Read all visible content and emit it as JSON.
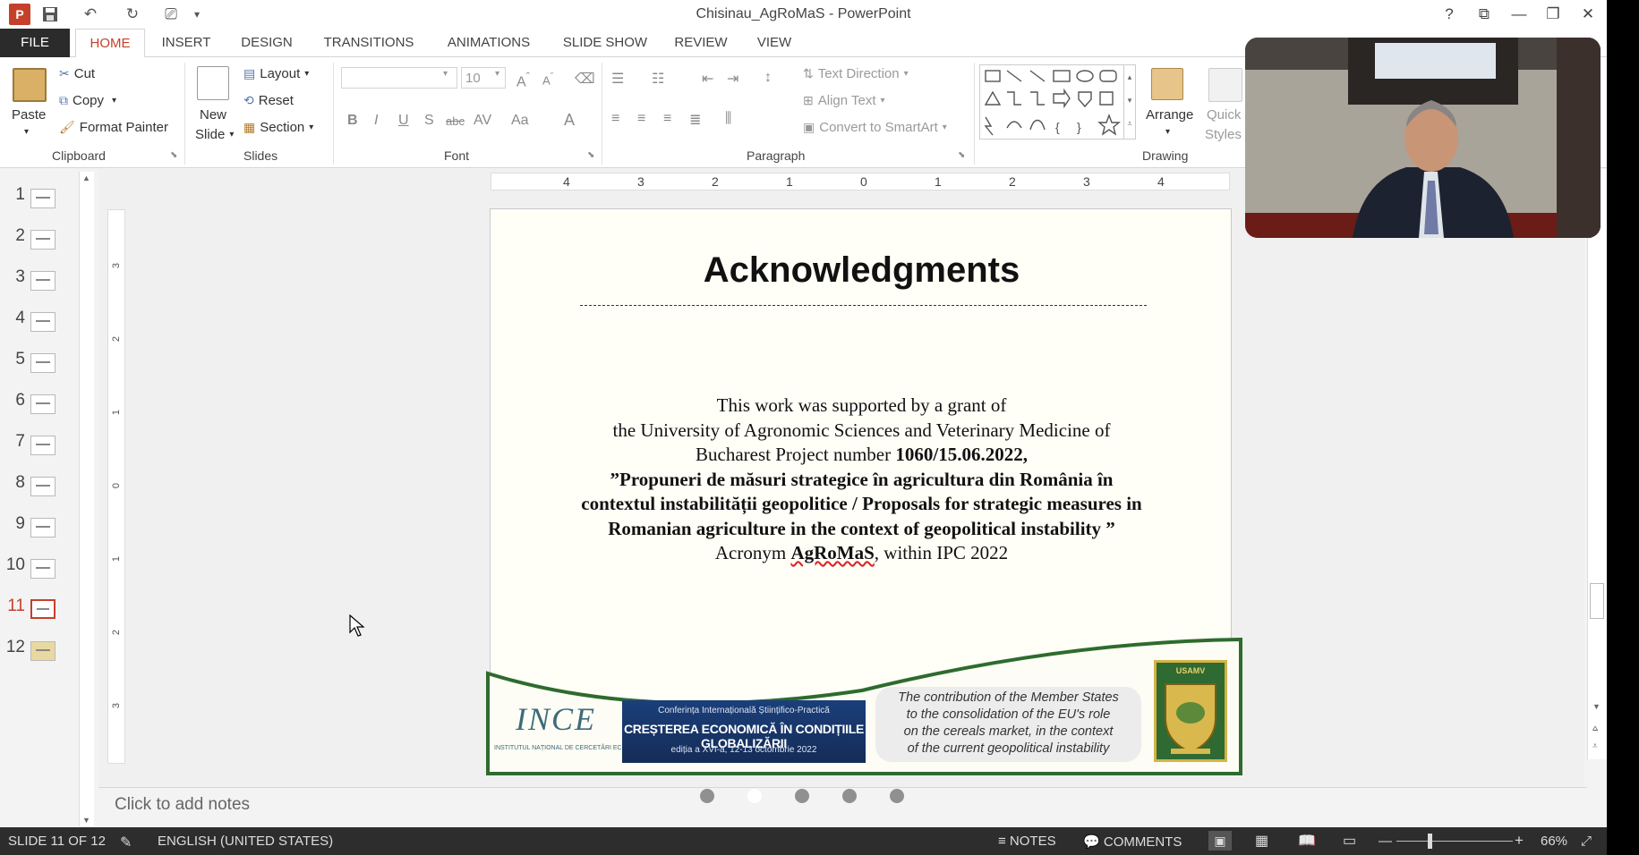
{
  "window": {
    "title": "Chisinau_AgRoMaS - PowerPoint",
    "help": "?",
    "restore_ribbon": "⧉",
    "minimize": "—",
    "maximize": "❐",
    "close": "✕"
  },
  "qat": {
    "save": "💾",
    "undo": "↶",
    "redo": "↻",
    "start": "⎚",
    "more": "▾"
  },
  "tabs": [
    "FILE",
    "HOME",
    "INSERT",
    "DESIGN",
    "TRANSITIONS",
    "ANIMATIONS",
    "SLIDE SHOW",
    "REVIEW",
    "VIEW"
  ],
  "active_tab": "HOME",
  "ribbon": {
    "clipboard": {
      "label": "Clipboard",
      "paste": "Paste",
      "cut": "Cut",
      "copy": "Copy",
      "format_painter": "Format Painter"
    },
    "slides": {
      "label": "Slides",
      "new_slide_1": "New",
      "new_slide_2": "Slide",
      "layout": "Layout",
      "reset": "Reset",
      "section": "Section"
    },
    "font": {
      "label": "Font",
      "font_name": "",
      "font_size": "10",
      "bold": "B",
      "italic": "I",
      "underline": "U",
      "shadow": "S",
      "strike": "abc",
      "spacing": "AV",
      "case": "Aa",
      "color": "A"
    },
    "paragraph": {
      "label": "Paragraph",
      "text_direction": "Text Direction",
      "align_text": "Align Text",
      "convert_smartart": "Convert to SmartArt"
    },
    "drawing": {
      "label": "Drawing",
      "arrange": "Arrange",
      "quick_styles_1": "Quick",
      "quick_styles_2": "Styles"
    }
  },
  "thumbnails": [
    "1",
    "2",
    "3",
    "4",
    "5",
    "6",
    "7",
    "8",
    "9",
    "10",
    "11",
    "12"
  ],
  "selected_slide": "11",
  "ruler_h": [
    "4",
    "3",
    "2",
    "1",
    "0",
    "1",
    "2",
    "3",
    "4"
  ],
  "ruler_v": [
    "3",
    "2",
    "1",
    "0",
    "1",
    "2",
    "3"
  ],
  "slide": {
    "title": "Acknowledgments",
    "line1": "This work was supported by a grant of",
    "line2": "the University of Agronomic Sciences and Veterinary Medicine of",
    "line3a": "Bucharest Project number ",
    "line3b": "1060/15.06.2022,",
    "line4": "”Propuneri de măsuri strategice în agricultura din România în",
    "line5": "contextul instabilității geopolitice / Proposals for strategic measures in",
    "line6": "Romanian agriculture in the context of geopolitical instability ”",
    "line7a": "Acronym ",
    "line7b": "AgRoMaS",
    "line7c": ", within IPC 2022",
    "footer": {
      "ince": "INCE",
      "ince_sub": "INSTITUTUL NAȚIONAL DE CERCETĂRI ECONOMICE",
      "conf_1": "Conferința Internațională Științifico-Practică",
      "conf_2": "CREȘTEREA ECONOMICĂ ÎN CONDIȚIILE GLOBALIZĂRII",
      "conf_3": "ediția a XVI-a,     12-13 octombrie 2022",
      "contribution": [
        "The contribution of the Member States",
        "to the consolidation of the EU's role",
        "on the cereals market, in the context",
        "of the current geopolitical instability"
      ],
      "usamv": "USAMV"
    }
  },
  "notes_placeholder": "Click to add notes",
  "status": {
    "slide": "SLIDE 11 OF 12",
    "language": "ENGLISH (UNITED STATES)",
    "notes": "NOTES",
    "comments": "COMMENTS",
    "zoom": "66%"
  },
  "colors": {
    "accent": "#c5402a",
    "status_bg": "#2d2d2d",
    "footer_green": "#2e6b2e"
  }
}
